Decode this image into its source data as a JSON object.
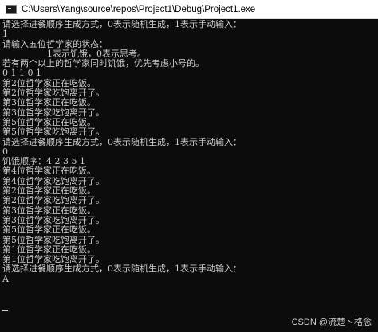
{
  "window": {
    "title": "C:\\Users\\Yang\\source\\repos\\Project1\\Debug\\Project1.exe"
  },
  "console": {
    "lines": [
      "请选择进餐顺序生成方式，0表示随机生成，1表示手动输入：",
      "1",
      "请输入五位哲学家的状态：",
      "                1表示饥饿，0表示思考。",
      "若有两个以上的哲学家同时饥饿，优先考虑小号的。",
      "0 1 1 0 1",
      "第2位哲学家正在吃饭。",
      "第2位哲学家吃饱离开了。",
      "第3位哲学家正在吃饭。",
      "第3位哲学家吃饱离开了。",
      "第5位哲学家正在吃饭。",
      "第5位哲学家吃饱离开了。",
      "请选择进餐顺序生成方式，0表示随机生成，1表示手动输入：",
      "0",
      "饥饿顺序：4 2 3 5 1",
      "第4位哲学家正在吃饭。",
      "第4位哲学家吃饱离开了。",
      "第2位哲学家正在吃饭。",
      "第2位哲学家吃饱离开了。",
      "第3位哲学家正在吃饭。",
      "第3位哲学家吃饱离开了。",
      "第5位哲学家正在吃饭。",
      "第5位哲学家吃饱离开了。",
      "第1位哲学家正在吃饭。",
      "第1位哲学家吃饱离开了。",
      "请选择进餐顺序生成方式，0表示随机生成，1表示手动输入：",
      "A"
    ]
  },
  "watermark": "CSDN @流楚丶格念",
  "colors": {
    "console_background": "#0c0c0c",
    "console_text": "#cccccc",
    "titlebar_background": "#ffffff"
  },
  "icons": {
    "app": "console-window-icon"
  }
}
